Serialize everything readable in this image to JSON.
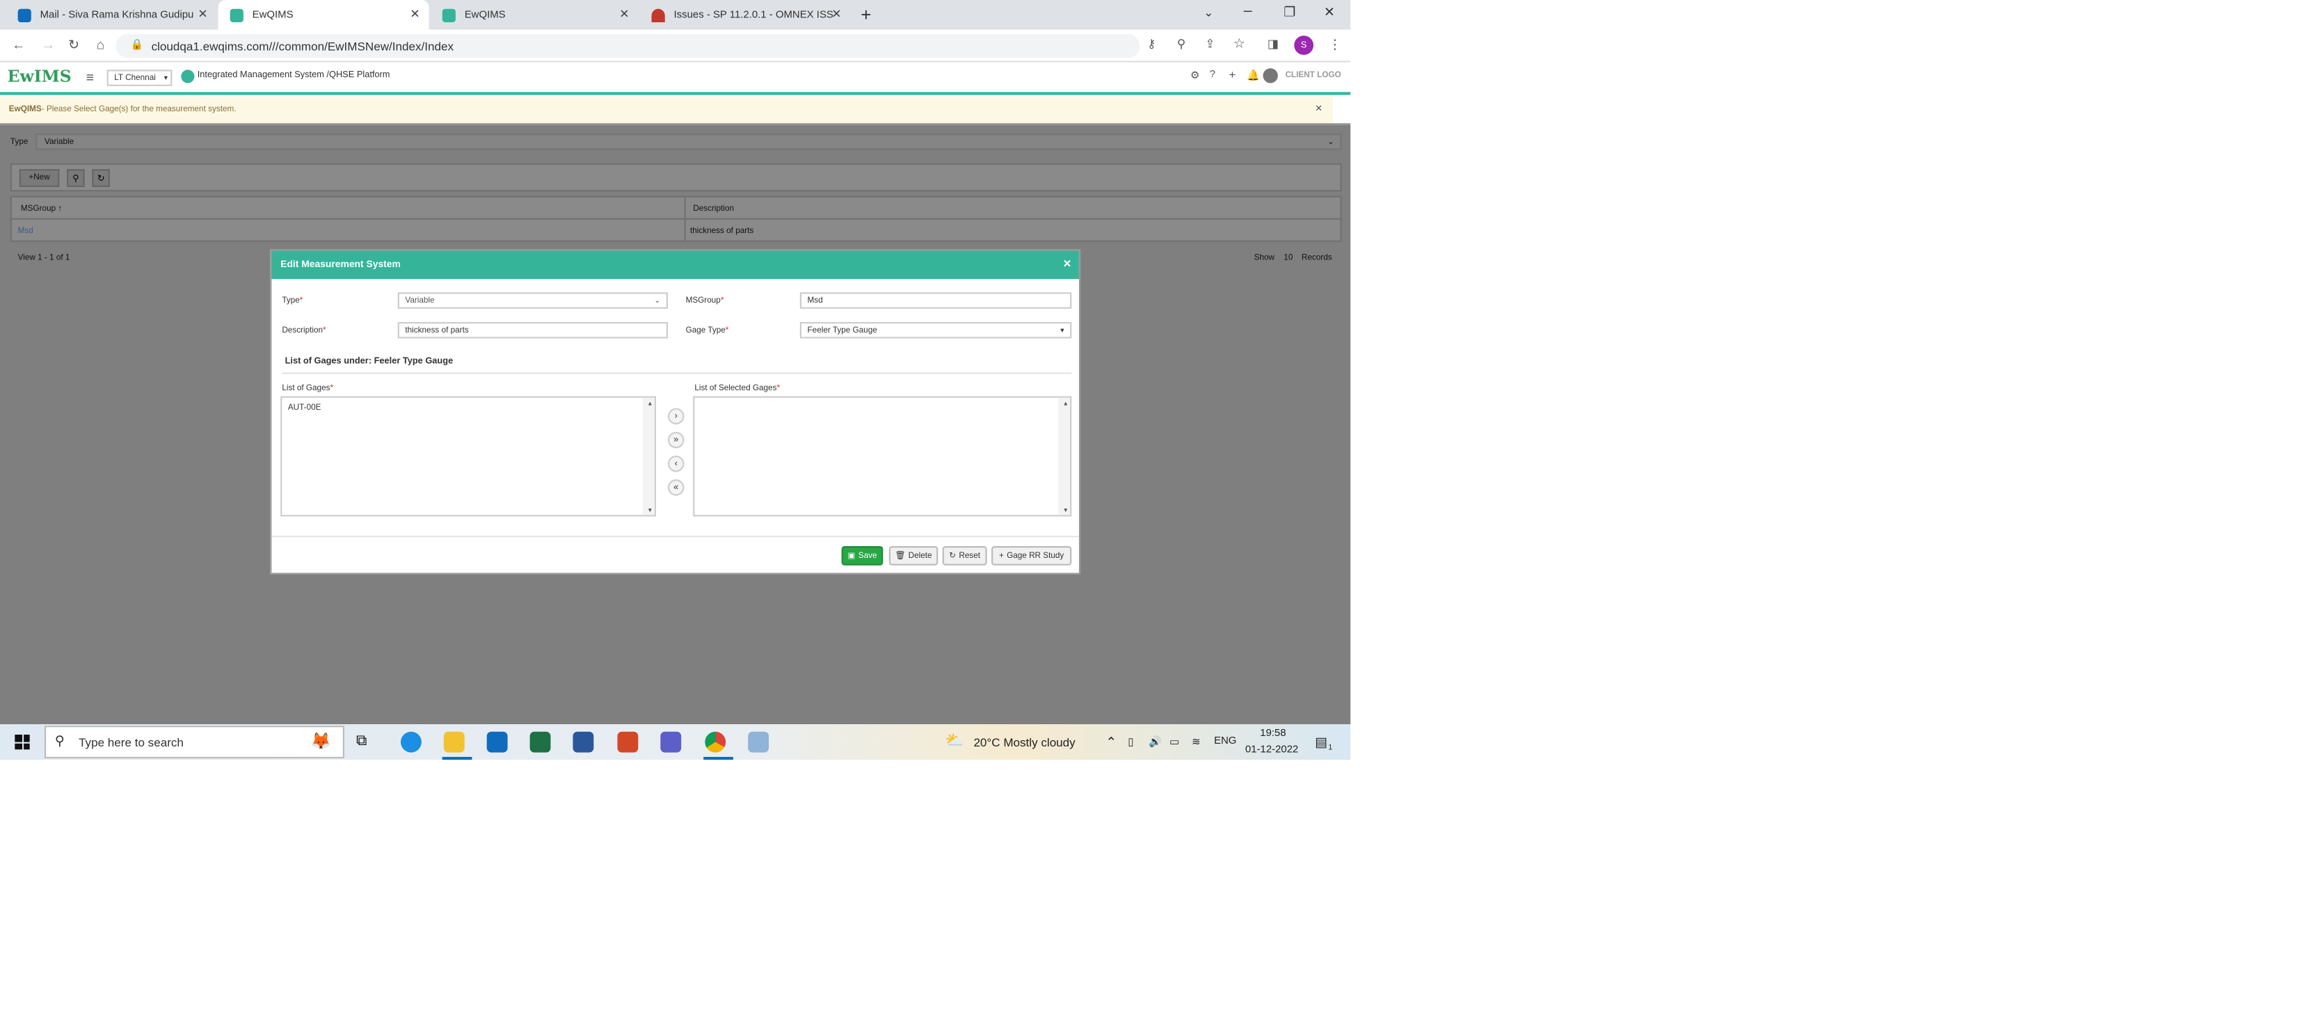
{
  "tabs": [
    {
      "label": "Mail - Siva Rama Krishna Gudipu",
      "color": "#0f6cbd"
    },
    {
      "label": "EwQIMS",
      "color": "#35b49a"
    },
    {
      "label": "EwQIMS",
      "color": "#35b49a"
    },
    {
      "label": "Issues - SP 11.2.0.1 - OMNEX ISS",
      "color": "#c0392b"
    }
  ],
  "address": {
    "url": "cloudqa1.ewqims.com///common/EwIMSNew/Index/Index"
  },
  "app": {
    "logo_text": "EwIMS",
    "location": "LT Chennai",
    "platform": "Integrated Management System /QHSE Platform",
    "client_logo": "CLIENT LOGO",
    "avatar": "S"
  },
  "banner": {
    "app": "EwQIMS",
    "message": " - Please Select Gage(s) for the measurement system."
  },
  "filter": {
    "type_label": "Type",
    "type_value": "Variable"
  },
  "toolbar": {
    "new_label": "New"
  },
  "grid": {
    "columns": [
      "MSGroup",
      "Description"
    ],
    "rows": [
      {
        "msgroup": "Msd",
        "description": "thickness of parts"
      }
    ],
    "footer": "View 1 - 1 of 1",
    "show_label": "Show",
    "page_size": "10",
    "records_label": "Records"
  },
  "modal": {
    "title": "Edit Measurement System",
    "type_label": "Type",
    "type_value": "Variable",
    "msgroup_label": "MSGroup",
    "msgroup_value": "Msd",
    "description_label": "Description",
    "description_value": "thickness of parts",
    "gage_type_label": "Gage Type",
    "gage_type_value": "Feeler Type Gauge",
    "list_heading": "List of Gages under: Feeler Type Gauge",
    "gages_label": "List of Gages",
    "gages": [
      "AUT-00E"
    ],
    "selected_label": "List of Selected Gages",
    "save": "Save",
    "delete": "Delete",
    "reset": "Reset",
    "gage_rr": "Gage RR Study"
  },
  "taskbar": {
    "search_placeholder": "Type here to search",
    "weather": "20°C  Mostly cloudy",
    "lang": "ENG",
    "time": "19:58",
    "date": "01-12-2022",
    "notif_count": "1"
  }
}
